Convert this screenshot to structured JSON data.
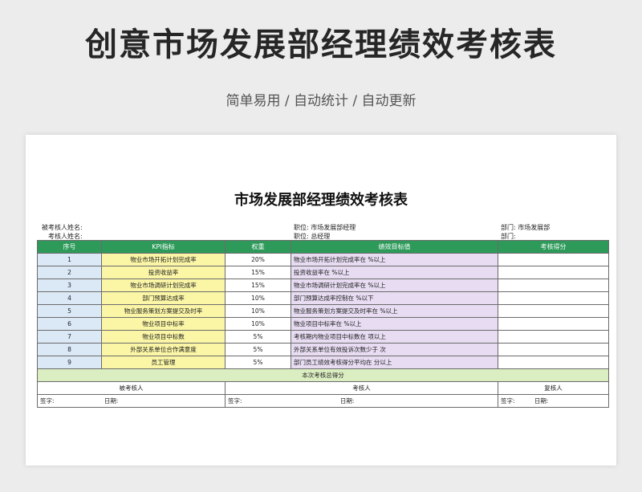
{
  "header": {
    "title": "创意市场发展部经理绩效考核表",
    "subtitle": "简单易用 / 自动统计 / 自动更新"
  },
  "sheet": {
    "title": "市场发展部经理绩效考核表",
    "info": {
      "assessee_label": "被考核人姓名:",
      "assessor_label": "考核人姓名:",
      "position1": "职位: 市场发展部经理",
      "position2": "职位: 总经理",
      "dept1": "部门: 市场发展部",
      "dept2": "部门:"
    },
    "columns": [
      "序号",
      "KPI指标",
      "权重",
      "绩效目标值",
      "考核得分"
    ],
    "rows": [
      {
        "no": "1",
        "kpi": "物业市场开拓计划完成率",
        "weight": "20%",
        "target": "物业市场开拓计划完成率在    %以上"
      },
      {
        "no": "2",
        "kpi": "投资收益率",
        "weight": "15%",
        "target": "投资收益率在    %以上"
      },
      {
        "no": "3",
        "kpi": "物业市场调研计划完成率",
        "weight": "15%",
        "target": "物业市场调研计划完成率在    %以上"
      },
      {
        "no": "4",
        "kpi": "部门预算达成率",
        "weight": "10%",
        "target": "部门预算达成率控制在    %以下"
      },
      {
        "no": "5",
        "kpi": "物业服务策划方案提交及时率",
        "weight": "10%",
        "target": "物业服务策划方案提交及时率在    %以上"
      },
      {
        "no": "6",
        "kpi": "物业项目中标率",
        "weight": "10%",
        "target": "物业项目中标率在    %以上"
      },
      {
        "no": "7",
        "kpi": "物业项目中标数",
        "weight": "5%",
        "target": "考核期内物业项目中标数在    项以上"
      },
      {
        "no": "8",
        "kpi": "外部关系单位合作满意度",
        "weight": "5%",
        "target": "外部关系单位有效投诉次数少于    次"
      },
      {
        "no": "9",
        "kpi": "员工管理",
        "weight": "5%",
        "target": "部门员工绩效考核得分平均在    分以上"
      }
    ],
    "total_label": "本次考核总得分",
    "signatures": {
      "assessee": "被考核人",
      "assessor": "考核人",
      "reviewer": "复核人",
      "sign_label": "签字:",
      "date_label": "日期:"
    }
  }
}
